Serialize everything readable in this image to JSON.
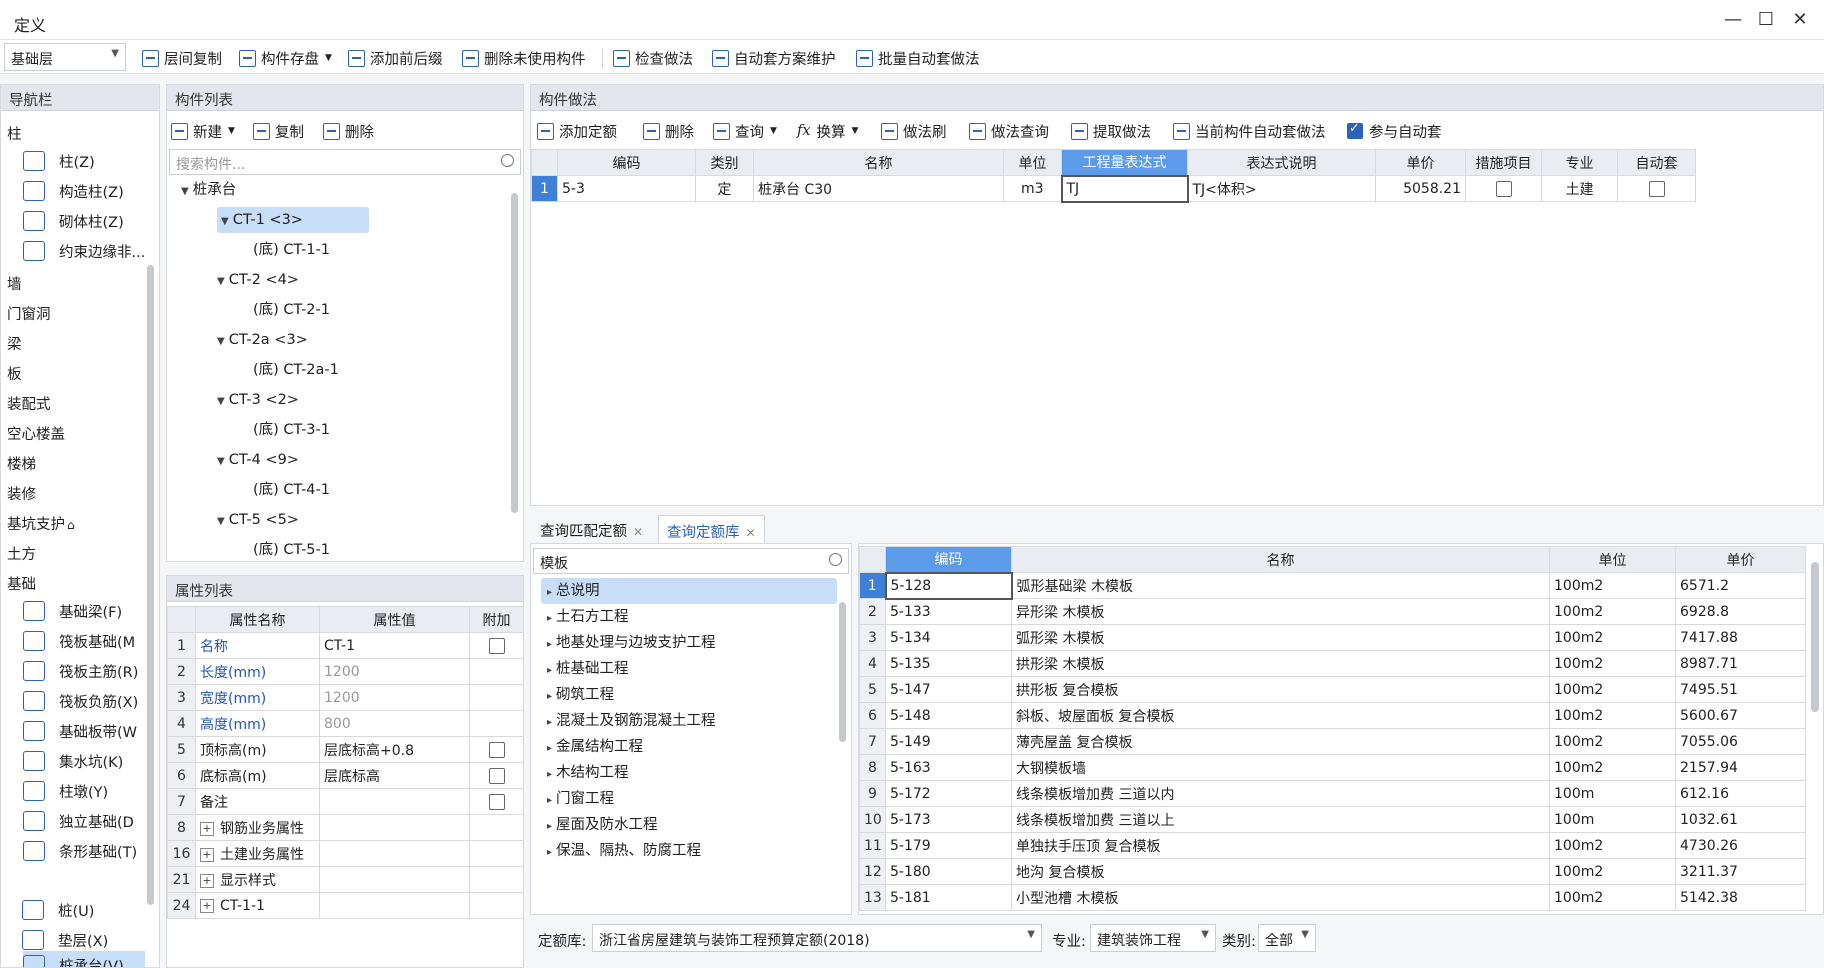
{
  "window": {
    "title": "定义",
    "min": "—",
    "max": "☐",
    "close": "✕"
  },
  "toolbar": {
    "floor_select": "基础层",
    "buttons": [
      {
        "label": "层间复制",
        "icon": "copy-floor-icon"
      },
      {
        "label": "构件存盘",
        "icon": "save-component-icon"
      },
      {
        "label": "添加前后缀",
        "icon": "add-prefix-icon"
      },
      {
        "label": "删除未使用构件",
        "icon": "delete-unused-icon"
      },
      {
        "label": "检查做法",
        "icon": "check-method-icon"
      },
      {
        "label": "自动套方案维护",
        "icon": "auto-plan-icon"
      },
      {
        "label": "批量自动套做法",
        "icon": "batch-auto-icon"
      }
    ]
  },
  "nav": {
    "header": "导航栏",
    "col": "柱",
    "col_items": [
      "柱(Z)",
      "构造柱(Z)",
      "砌体柱(Z)",
      "约束边缘非..."
    ],
    "cats_mid": [
      "墙",
      "门窗洞",
      "梁",
      "板",
      "装配式",
      "空心楼盖",
      "楼梯",
      "装修",
      "基坑支护",
      "土方",
      "基础"
    ],
    "base_items": [
      "基础梁(F)",
      "筏板基础(M",
      "筏板主筋(R)",
      "筏板负筋(X)",
      "基础板带(W",
      "集水坑(K)",
      "柱墩(Y)",
      "独立基础(D",
      "条形基础(T)",
      "桩承台(V)",
      "桩(U)",
      "垫层(X)"
    ]
  },
  "complist": {
    "header": "构件列表",
    "btn_new": "新建",
    "btn_copy": "复制",
    "btn_delete": "删除",
    "search_placeholder": "搜索构件...",
    "root": "桩承台",
    "nodes": [
      {
        "parent": "CT-1 <3>",
        "child": "(底) CT-1-1"
      },
      {
        "parent": "CT-2 <4>",
        "child": "(底) CT-2-1"
      },
      {
        "parent": "CT-2a <3>",
        "child": "(底) CT-2a-1"
      },
      {
        "parent": "CT-3 <2>",
        "child": "(底) CT-3-1"
      },
      {
        "parent": "CT-4 <9>",
        "child": "(底) CT-4-1"
      },
      {
        "parent": "CT-5 <5>",
        "child": "(底) CT-5-1"
      }
    ]
  },
  "props": {
    "header": "属性列表",
    "cols": [
      "属性名称",
      "属性值",
      "附加"
    ],
    "rows": [
      {
        "no": "1",
        "name": "名称",
        "value": "CT-1",
        "cb": true,
        "blue": true,
        "gray": false,
        "expand": false
      },
      {
        "no": "2",
        "name": "长度(mm)",
        "value": "1200",
        "cb": false,
        "blue": true,
        "gray": true,
        "expand": false
      },
      {
        "no": "3",
        "name": "宽度(mm)",
        "value": "1200",
        "cb": false,
        "blue": true,
        "gray": true,
        "expand": false
      },
      {
        "no": "4",
        "name": "高度(mm)",
        "value": "800",
        "cb": false,
        "blue": true,
        "gray": true,
        "expand": false
      },
      {
        "no": "5",
        "name": "顶标高(m)",
        "value": "层底标高+0.8",
        "cb": true,
        "blue": false,
        "gray": false,
        "expand": false
      },
      {
        "no": "6",
        "name": "底标高(m)",
        "value": "层底标高",
        "cb": true,
        "blue": false,
        "gray": false,
        "expand": false
      },
      {
        "no": "7",
        "name": "备注",
        "value": "",
        "cb": true,
        "blue": false,
        "gray": false,
        "expand": false
      },
      {
        "no": "8",
        "name": "钢筋业务属性",
        "value": "",
        "cb": false,
        "blue": false,
        "gray": false,
        "expand": true
      },
      {
        "no": "16",
        "name": "土建业务属性",
        "value": "",
        "cb": false,
        "blue": false,
        "gray": false,
        "expand": true
      },
      {
        "no": "21",
        "name": "显示样式",
        "value": "",
        "cb": false,
        "blue": false,
        "gray": false,
        "expand": true
      },
      {
        "no": "24",
        "name": "CT-1-1",
        "value": "",
        "cb": false,
        "blue": false,
        "gray": false,
        "expand": true
      }
    ]
  },
  "method": {
    "header": "构件做法",
    "tools": [
      "添加定额",
      "删除",
      "查询",
      "换算",
      "做法刷",
      "做法查询",
      "提取做法",
      "当前构件自动套做法"
    ],
    "auto_check_label": "参与自动套",
    "cols": [
      "编码",
      "类别",
      "名称",
      "单位",
      "工程量表达式",
      "表达式说明",
      "单价",
      "措施项目",
      "专业",
      "自动套"
    ],
    "rows": [
      {
        "no": "1",
        "code": "5-3",
        "type": "定",
        "name": "桩承台 C30",
        "unit": "m3",
        "expr": "TJ",
        "desc": "TJ<体积>",
        "price": "5058.21",
        "major": "土建"
      }
    ]
  },
  "tabs": {
    "tab1": "查询匹配定额",
    "tab2": "查询定额库"
  },
  "lib": {
    "search_value": "模板",
    "items": [
      "总说明",
      "土石方工程",
      "地基处理与边坡支护工程",
      "桩基础工程",
      "砌筑工程",
      "混凝土及钢筋混凝土工程",
      "金属结构工程",
      "木结构工程",
      "门窗工程",
      "屋面及防水工程",
      "保温、隔热、防腐工程"
    ],
    "cols": [
      "编码",
      "名称",
      "单位",
      "单价"
    ],
    "rows": [
      {
        "no": "1",
        "code": "5-128",
        "name": "弧形基础梁 木模板",
        "unit": "100m2",
        "price": "6571.2"
      },
      {
        "no": "2",
        "code": "5-133",
        "name": "异形梁 木模板",
        "unit": "100m2",
        "price": "6928.8"
      },
      {
        "no": "3",
        "code": "5-134",
        "name": "弧形梁 木模板",
        "unit": "100m2",
        "price": "7417.88"
      },
      {
        "no": "4",
        "code": "5-135",
        "name": "拱形梁 木模板",
        "unit": "100m2",
        "price": "8987.71"
      },
      {
        "no": "5",
        "code": "5-147",
        "name": "拱形板 复合模板",
        "unit": "100m2",
        "price": "7495.51"
      },
      {
        "no": "6",
        "code": "5-148",
        "name": "斜板、坡屋面板 复合模板",
        "unit": "100m2",
        "price": "5600.67"
      },
      {
        "no": "7",
        "code": "5-149",
        "name": "薄壳屋盖 复合模板",
        "unit": "100m2",
        "price": "7055.06"
      },
      {
        "no": "8",
        "code": "5-163",
        "name": "大钢模板墙",
        "unit": "100m2",
        "price": "2157.94"
      },
      {
        "no": "9",
        "code": "5-172",
        "name": "线条模板增加费 三道以内",
        "unit": "100m",
        "price": "612.16"
      },
      {
        "no": "10",
        "code": "5-173",
        "name": "线条模板增加费 三道以上",
        "unit": "100m",
        "price": "1032.61"
      },
      {
        "no": "11",
        "code": "5-179",
        "name": "单独扶手压顶 复合模板",
        "unit": "100m2",
        "price": "4730.26"
      },
      {
        "no": "12",
        "code": "5-180",
        "name": "地沟 复合模板",
        "unit": "100m2",
        "price": "3211.37"
      },
      {
        "no": "13",
        "code": "5-181",
        "name": "小型池槽 木模板",
        "unit": "100m2",
        "price": "5142.38"
      }
    ],
    "footer": {
      "lib_label": "定额库:",
      "lib_value": "浙江省房屋建筑与装饰工程预算定额(2018)",
      "major_label": "专业:",
      "major_value": "建筑装饰工程",
      "type_label": "类别:",
      "type_value": "全部"
    }
  }
}
